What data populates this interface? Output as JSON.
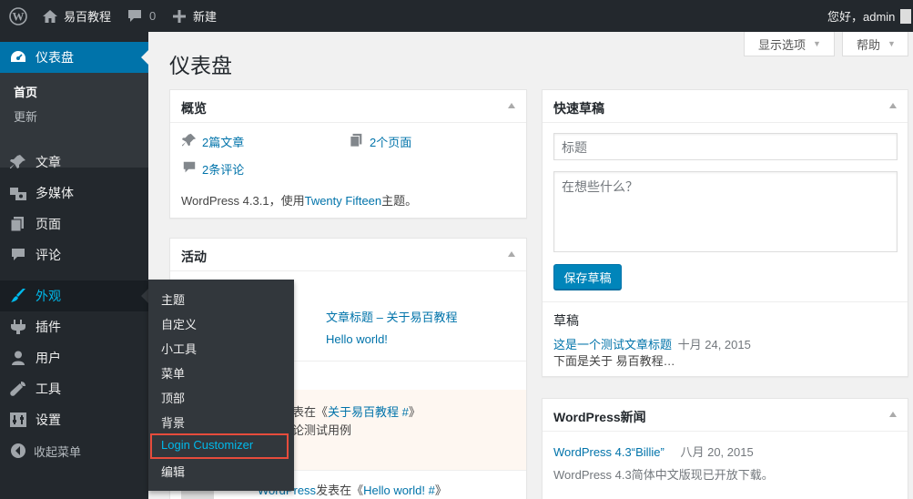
{
  "adminbar": {
    "site_name": "易百教程",
    "comment_count": "0",
    "new_label": "新建",
    "greeting": "您好，admin"
  },
  "sidebar": {
    "dashboard": "仪表盘",
    "dashboard_sub": [
      "首页",
      "更新"
    ],
    "items": [
      "文章",
      "多媒体",
      "页面",
      "评论",
      "外观",
      "插件",
      "用户",
      "工具",
      "设置"
    ],
    "collapse": "收起菜单"
  },
  "flyout": {
    "items": [
      "主题",
      "自定义",
      "小工具",
      "菜单",
      "顶部",
      "背景",
      "Login Customizer",
      "编辑"
    ]
  },
  "screen_options": "显示选项",
  "help": "帮助",
  "page_title": "仪表盘",
  "glance": {
    "title": "概览",
    "posts": "2篇文章",
    "pages": "2个页面",
    "comments": "2条评论",
    "version_prefix": "WordPress 4.3.1，使用",
    "theme": "Twenty Fifteen",
    "version_suffix": "主题。"
  },
  "activity": {
    "title": "活动",
    "recent_posts": [
      "文章标题 – 关于易百教程",
      "Hello world!"
    ],
    "comment1_prefix": "发表在《",
    "comment1_link": "关于易百教程 #",
    "comment1_suffix": "》",
    "comment1_text": "评论测试用例",
    "comment2_author": "WordPress",
    "comment2_prefix": "发表在《",
    "comment2_link": "Hello world! #",
    "comment2_suffix": "》"
  },
  "quickdraft": {
    "title": "快速草稿",
    "title_placeholder": "标题",
    "content_placeholder": "在想些什么？",
    "save_label": "保存草稿",
    "drafts_heading": "草稿",
    "draft_link": "这是一个测试文章标题",
    "draft_date": "十月 24, 2015",
    "draft_excerpt": "下面是关于 易百教程…"
  },
  "news": {
    "title": "WordPress新闻",
    "item_link": "WordPress 4.3“Billie”",
    "item_date": "八月 20, 2015",
    "item_desc": "WordPress 4.3简体中文版现已开放下载。"
  },
  "colors": {
    "adminbar": "#23282d",
    "accent": "#0073aa",
    "hover_link": "#00b9eb",
    "highlight": "#e74c3c"
  }
}
